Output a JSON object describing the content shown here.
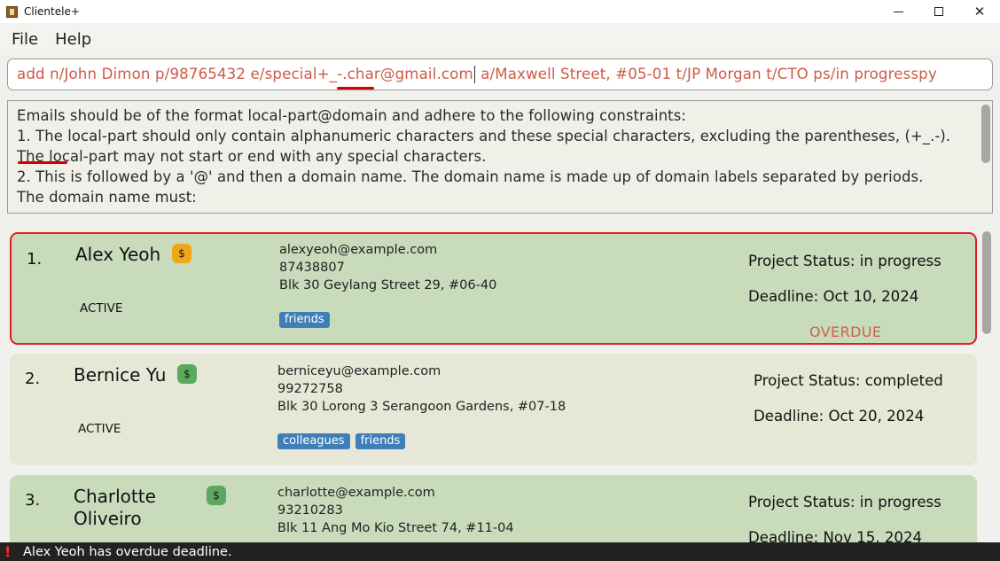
{
  "window": {
    "title": "Clientele+",
    "minimize_icon": "minimize-icon",
    "maximize_icon": "maximize-icon",
    "close_icon": "✕"
  },
  "menu": {
    "file": "File",
    "help": "Help"
  },
  "command": {
    "before_caret": "add n/John Dimon p/98765432 e/special+_-.char@gmail.com",
    "after_caret": " a/Maxwell Street, #05-01 t/JP Morgan t/CTO ps/in progresspy"
  },
  "result": {
    "text": "Emails should be of the format local-part@domain and adhere to the following constraints:\n1. The local-part should only contain alphanumeric characters and these special characters, excluding the parentheses, (+_.-). The local-part may not start or end with any special characters.\n2. This is followed by a '@' and then a domain name. The domain name is made up of domain labels separated by periods.\nThe domain name must:"
  },
  "clients": [
    {
      "index": "1.",
      "name": "Alex Yeoh",
      "payment_icon": "$",
      "payment_color": "#f2a516",
      "state": "ACTIVE",
      "email": "alexyeoh@example.com",
      "phone": "87438807",
      "address": "Blk 30 Geylang Street 29, #06-40",
      "tags": [
        "friends"
      ],
      "project_status": "Project Status: in progress",
      "deadline": "Deadline: Oct 10, 2024",
      "overdue": "OVERDUE"
    },
    {
      "index": "2.",
      "name": "Bernice Yu",
      "payment_icon": "$",
      "payment_color": "#5aa95d",
      "state": "ACTIVE",
      "email": "berniceyu@example.com",
      "phone": "99272758",
      "address": "Blk 30 Lorong 3 Serangoon Gardens, #07-18",
      "tags": [
        "colleagues",
        "friends"
      ],
      "project_status": "Project Status: completed",
      "deadline": "Deadline: Oct 20, 2024"
    },
    {
      "index": "3.",
      "name_line1": "Charlotte",
      "name_line2": "Oliveiro",
      "payment_icon": "$",
      "payment_color": "#5aa95d",
      "email": "charlotte@example.com",
      "phone": "93210283",
      "address": "Blk 11 Ang Mo Kio Street 74, #11-04",
      "project_status": "Project Status: in progress",
      "deadline": "Deadline: Nov 15, 2024"
    }
  ],
  "status_bar": {
    "icon": "!",
    "message": "Alex Yeoh has overdue deadline."
  }
}
